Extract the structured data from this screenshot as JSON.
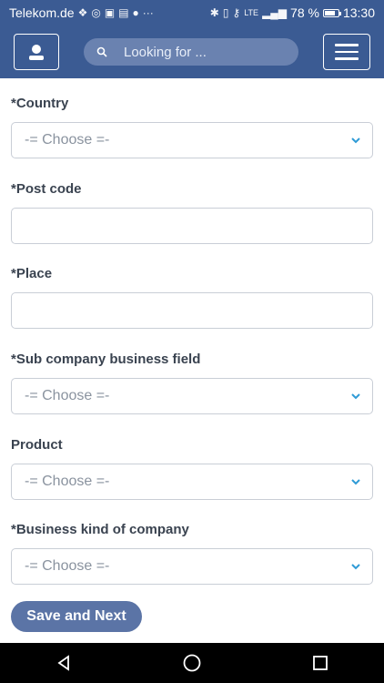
{
  "status_bar": {
    "carrier": "Telekom.de",
    "icons_left": [
      "cloud-icon",
      "whatsapp-icon",
      "calendar-icon",
      "image-icon",
      "pinterest-icon",
      "more-icon"
    ],
    "more": "···",
    "network": "LTE",
    "battery": "78 %",
    "time": "13:30"
  },
  "header": {
    "search_placeholder": "Looking for ..."
  },
  "form": {
    "country_label": "*Country",
    "country_value": "-= Choose =-",
    "postcode_label": "*Post code",
    "place_label": "*Place",
    "sub_business_label": "*Sub company business field",
    "sub_business_value": "-= Choose =-",
    "product_label": "Product",
    "product_value": "-= Choose =-",
    "business_kind_label": "*Business kind of company",
    "business_kind_value": "-= Choose =-"
  },
  "buttons": {
    "save_next": "Save and Next"
  },
  "colors": {
    "header_bg": "#3b5b93",
    "search_bg": "#6a82b0",
    "button_bg": "#5b74a6",
    "chevron": "#2f9bd6"
  }
}
